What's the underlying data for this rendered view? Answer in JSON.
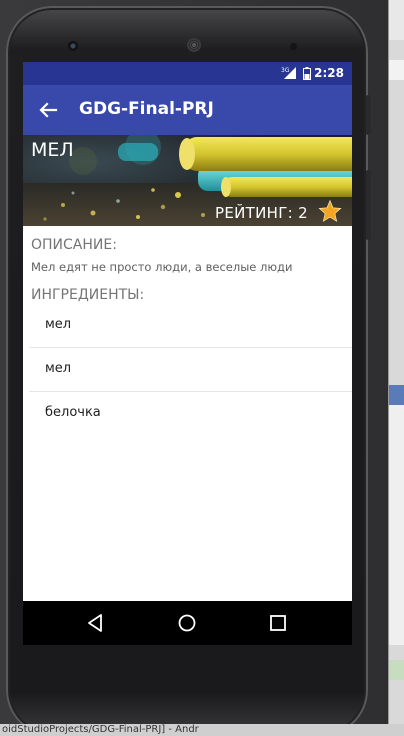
{
  "status_bar": {
    "time": "2:28",
    "network_label": "3G",
    "icons": [
      "signal-icon",
      "battery-icon"
    ]
  },
  "app_bar": {
    "title": "GDG-Final-PRJ",
    "back_icon": "arrow-back-icon"
  },
  "recipe": {
    "name": "МЕЛ",
    "rating_text": "РЕЙТИНГ: 2",
    "rating_icon": "star-icon"
  },
  "description": {
    "label": "ОПИСАНИЕ:",
    "text": "Мел едят не просто люди, а веселые люди"
  },
  "ingredients": {
    "label": "ИНГРЕДИЕНТЫ:",
    "items": [
      {
        "name": "мел"
      },
      {
        "name": "мел"
      },
      {
        "name": "белочка"
      }
    ]
  },
  "nav_bar": {
    "buttons": [
      "back-triangle-icon",
      "home-circle-icon",
      "recents-square-icon"
    ]
  },
  "ide_footer_text": "oidStudioProjects/GDG-Final-PRJ] - Andr",
  "colors": {
    "status_bar": "#283593",
    "app_bar": "#3949ab",
    "star": "#f4a623",
    "section_label": "#757575"
  }
}
